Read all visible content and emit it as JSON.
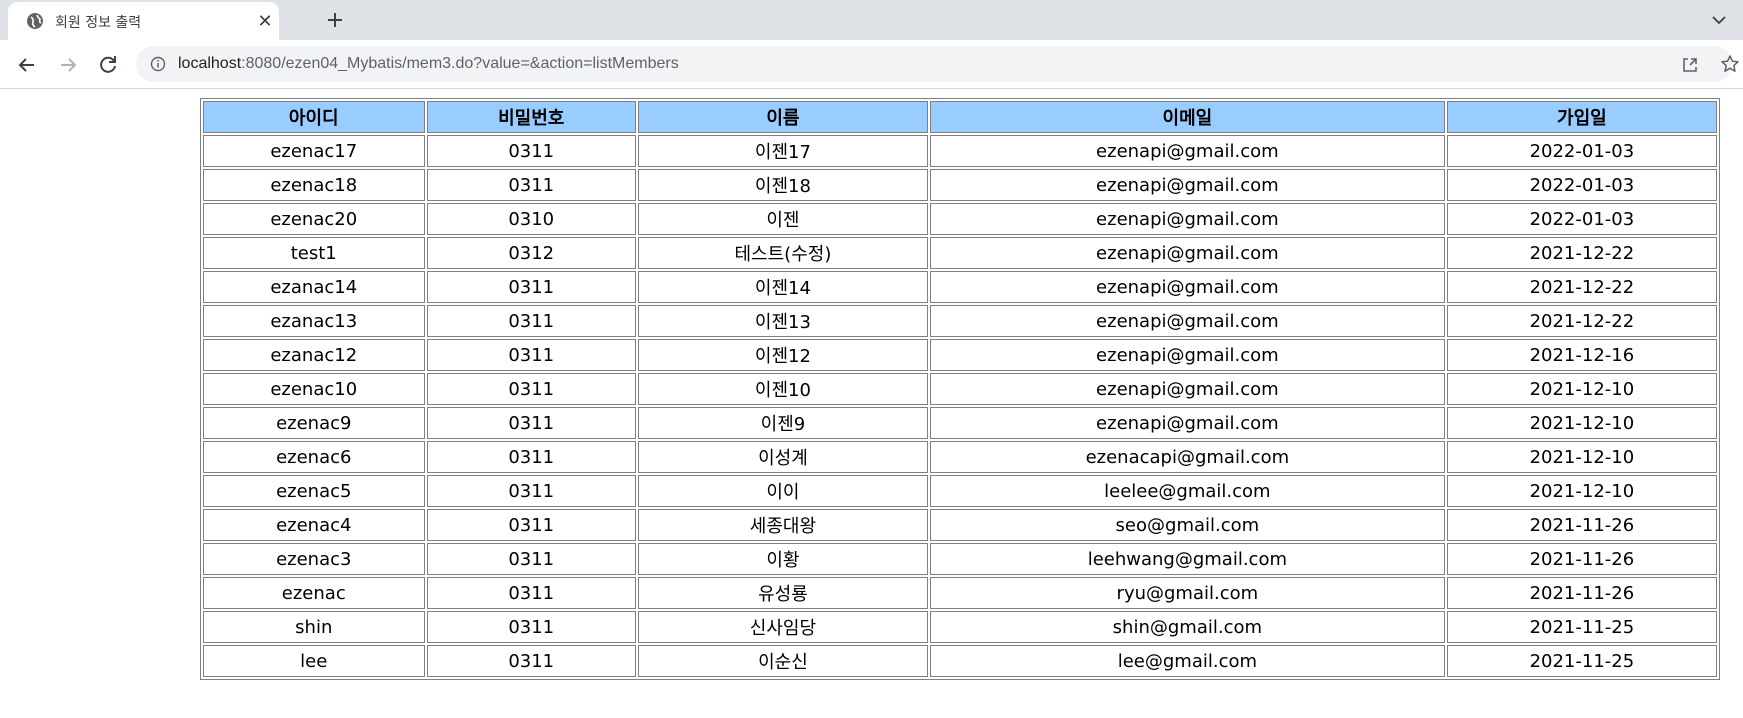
{
  "browser": {
    "tab_title": "회원 정보 출력",
    "url_host": "localhost",
    "url_rest": ":8080/ezen04_Mybatis/mem3.do?value=&action=listMembers"
  },
  "table": {
    "headers": [
      "아이디",
      "비밀번호",
      "이름",
      "이메일",
      "가입일"
    ],
    "header_color": "#99ccff",
    "rows": [
      [
        "ezenac17",
        "0311",
        "이젠17",
        "ezenapi@gmail.com",
        "2022-01-03"
      ],
      [
        "ezenac18",
        "0311",
        "이젠18",
        "ezenapi@gmail.com",
        "2022-01-03"
      ],
      [
        "ezenac20",
        "0310",
        "이젠",
        "ezenapi@gmail.com",
        "2022-01-03"
      ],
      [
        "test1",
        "0312",
        "테스트(수정)",
        "ezenapi@gmail.com",
        "2021-12-22"
      ],
      [
        "ezanac14",
        "0311",
        "이젠14",
        "ezenapi@gmail.com",
        "2021-12-22"
      ],
      [
        "ezanac13",
        "0311",
        "이젠13",
        "ezenapi@gmail.com",
        "2021-12-22"
      ],
      [
        "ezanac12",
        "0311",
        "이젠12",
        "ezenapi@gmail.com",
        "2021-12-16"
      ],
      [
        "ezenac10",
        "0311",
        "이젠10",
        "ezenapi@gmail.com",
        "2021-12-10"
      ],
      [
        "ezenac9",
        "0311",
        "이젠9",
        "ezenapi@gmail.com",
        "2021-12-10"
      ],
      [
        "ezenac6",
        "0311",
        "이성계",
        "ezenacapi@gmail.com",
        "2021-12-10"
      ],
      [
        "ezenac5",
        "0311",
        "이이",
        "leelee@gmail.com",
        "2021-12-10"
      ],
      [
        "ezenac4",
        "0311",
        "세종대왕",
        "seo@gmail.com",
        "2021-11-26"
      ],
      [
        "ezenac3",
        "0311",
        "이황",
        "leehwang@gmail.com",
        "2021-11-26"
      ],
      [
        "ezenac",
        "0311",
        "유성룡",
        "ryu@gmail.com",
        "2021-11-26"
      ],
      [
        "shin",
        "0311",
        "신사임당",
        "shin@gmail.com",
        "2021-11-25"
      ],
      [
        "lee",
        "0311",
        "이순신",
        "lee@gmail.com",
        "2021-11-25"
      ]
    ]
  }
}
